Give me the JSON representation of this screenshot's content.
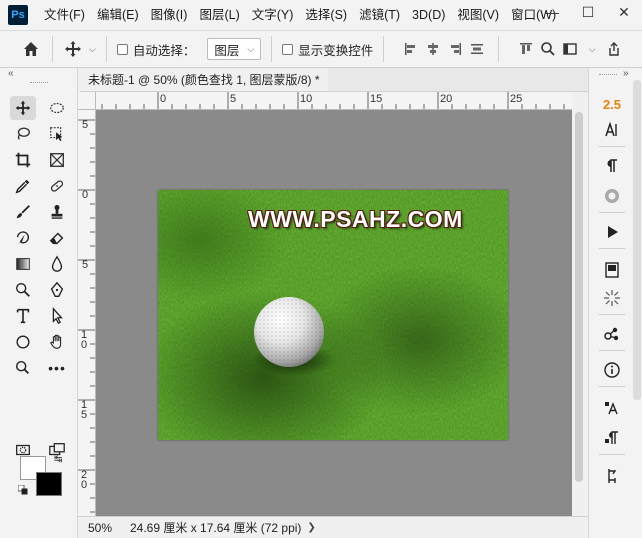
{
  "app": {
    "logo_text": "Ps",
    "menu": [
      "文件(F)",
      "编辑(E)",
      "图像(I)",
      "图层(L)",
      "文字(Y)",
      "选择(S)",
      "滤镜(T)",
      "3D(D)",
      "视图(V)",
      "窗口(W)"
    ]
  },
  "window_controls": {
    "minimize": "—",
    "maximize": "☐",
    "close": "✕"
  },
  "options_bar": {
    "auto_select_label": "自动选择：",
    "auto_select_checked": false,
    "auto_select_target": "图层",
    "show_transform_label": "显示变换控件",
    "show_transform_checked": false
  },
  "document": {
    "tab_title": "未标题-1 @ 50% (颜色查找 1, 图层蒙版/8) *",
    "close_glyph": "×",
    "watermark_text": "WWW.PSAHZ.COM"
  },
  "rulers": {
    "horizontal_labels": [
      "0",
      "5",
      "10",
      "15",
      "20",
      "25"
    ],
    "vertical_labels": [
      "5",
      "0",
      "5",
      "10",
      "15",
      "20"
    ]
  },
  "status": {
    "zoom": "50%",
    "doc_info": "24.69 厘米 x 17.64 厘米 (72 ppi)"
  },
  "right_panel": {
    "glyph_size_value": "2.5"
  },
  "colors": {
    "foreground": "#ffffff",
    "background": "#000000",
    "accent_value": "#e8820c",
    "canvas_bg": "#8a8a8a"
  },
  "icons": {
    "home": "home-icon",
    "move": "move-icon",
    "search": "search-icon",
    "share": "share-icon"
  }
}
